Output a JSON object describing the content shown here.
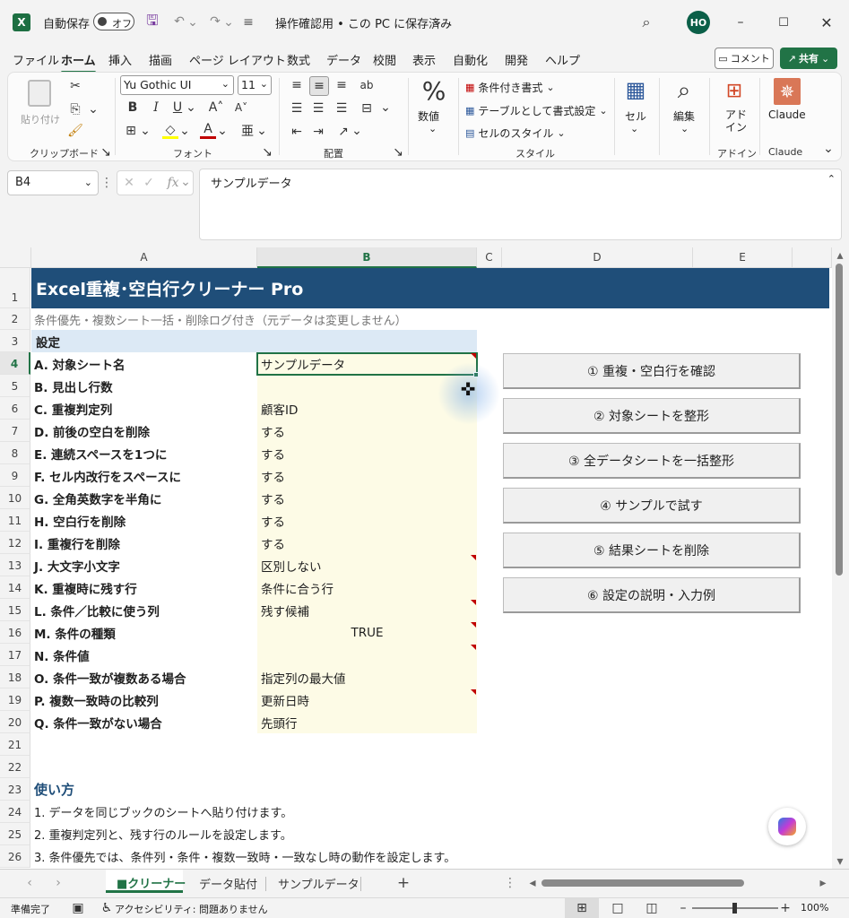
{
  "titlebar": {
    "autosave_label": "自動保存",
    "autosave_toggle": "オフ",
    "doc_title": "操作確認用 • この PC に保存済み",
    "avatar": "HO"
  },
  "menu": {
    "items": [
      "ファイル",
      "ホーム",
      "挿入",
      "描画",
      "ページ レイアウト",
      "数式",
      "データ",
      "校閲",
      "表示",
      "自動化",
      "開発",
      "ヘルプ"
    ],
    "active": "ホーム",
    "comment_label": "コメント",
    "share_label": "共有"
  },
  "ribbon": {
    "paste_label": "貼り付け",
    "clipboard_label": "クリップボード",
    "font_name": "Yu Gothic UI",
    "font_size": "11",
    "font_group": "フォント",
    "align_group": "配置",
    "number_label": "数値",
    "cond_format": "条件付き書式",
    "table_format": "テーブルとして書式設定",
    "cell_style": "セルのスタイル",
    "style_group": "スタイル",
    "cell_label": "セル",
    "edit_label": "編集",
    "addin_label": "アド\nイン",
    "addin_group": "アドイン",
    "claude_label": "Claude",
    "claude_group": "Claude"
  },
  "formula_bar": {
    "name_box": "B4",
    "fx": "fx",
    "content": "サンプルデータ"
  },
  "columns": [
    "A",
    "B",
    "C",
    "D",
    "E"
  ],
  "rows": [
    "1",
    "2",
    "3",
    "4",
    "5",
    "6",
    "7",
    "8",
    "9",
    "10",
    "11",
    "12",
    "13",
    "14",
    "15",
    "16",
    "17",
    "18",
    "19",
    "20",
    "21",
    "22",
    "23",
    "24",
    "25",
    "26"
  ],
  "sheet": {
    "title": "Excel重複･空白行クリーナー Pro",
    "subtitle": "条件優先・複数シート一括・削除ログ付き（元データは変更しません）",
    "settings_header": "設定",
    "settings": [
      {
        "label": "A. 対象シート名",
        "value": "サンプルデータ"
      },
      {
        "label": "B. 見出し行数",
        "value": ""
      },
      {
        "label": "C. 重複判定列",
        "value": "顧客ID"
      },
      {
        "label": "D. 前後の空白を削除",
        "value": "する"
      },
      {
        "label": "E. 連続スペースを1つに",
        "value": "する"
      },
      {
        "label": "F. セル内改行をスペースに",
        "value": "する"
      },
      {
        "label": "G. 全角英数字を半角に",
        "value": "する"
      },
      {
        "label": "H. 空白行を削除",
        "value": "する"
      },
      {
        "label": "I. 重複行を削除",
        "value": "する"
      },
      {
        "label": "J. 大文字小文字",
        "value": "区別しない"
      },
      {
        "label": "K. 重複時に残す行",
        "value": "条件に合う行"
      },
      {
        "label": "L. 条件／比較に使う列",
        "value": "残す候補"
      },
      {
        "label": "M. 条件の種類",
        "value": "TRUE"
      },
      {
        "label": "N. 条件値",
        "value": ""
      },
      {
        "label": "O. 条件一致が複数ある場合",
        "value": "指定列の最大値"
      },
      {
        "label": "P. 複数一致時の比較列",
        "value": "更新日時"
      },
      {
        "label": "Q. 条件一致がない場合",
        "value": "先頭行"
      }
    ],
    "buttons": [
      "① 重複・空白行を確認",
      "② 対象シートを整形",
      "③ 全データシートを一括整形",
      "④ サンプルで試す",
      "⑤ 結果シートを削除",
      "⑥ 設定の説明・入力例"
    ],
    "howto_header": "使い方",
    "howto": [
      "1. データを同じブックのシートへ貼り付けます。",
      "2. 重複判定列と、残す行のルールを設定します。",
      "3. 条件優先では、条件列・条件・複数一致時・一致なし時の動作を設定します。"
    ]
  },
  "tabs": {
    "items": [
      "■クリーナー",
      "データ貼付",
      "サンプルデータ"
    ],
    "active": "■クリーナー",
    "add": "+"
  },
  "status": {
    "ready": "準備完了",
    "accessibility": "アクセシビリティ: 問題ありません",
    "zoom": "100%"
  },
  "colors": {
    "excel_green": "#217346",
    "title_band": "#1f4e79",
    "settings_band": "#dce9f5",
    "value_fill": "#fdfbe6",
    "comment_marker": "#c00000",
    "howto_header": "#1f4e79"
  }
}
